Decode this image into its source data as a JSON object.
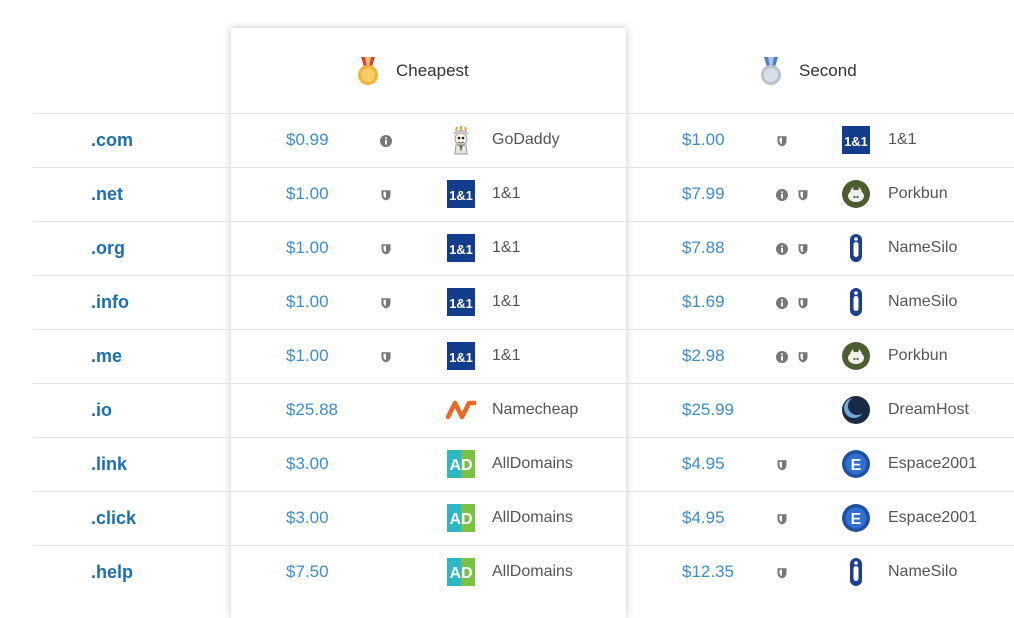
{
  "columns": [
    {
      "label": "Cheapest",
      "medal": "gold-medal-icon"
    },
    {
      "label": "Second",
      "medal": "silver-medal-icon"
    }
  ],
  "rows": [
    {
      "tld": ".com",
      "cheapest": {
        "price": "$0.99",
        "registrar": "GoDaddy",
        "logo": "godaddy",
        "badges": [
          "info"
        ]
      },
      "second": {
        "price": "$1.00",
        "registrar": "1&1",
        "logo": "ionos",
        "badges": [
          "shield"
        ]
      }
    },
    {
      "tld": ".net",
      "cheapest": {
        "price": "$1.00",
        "registrar": "1&1",
        "logo": "ionos",
        "badges": [
          "shield"
        ]
      },
      "second": {
        "price": "$7.99",
        "registrar": "Porkbun",
        "logo": "porkbun",
        "badges": [
          "info",
          "shield"
        ]
      }
    },
    {
      "tld": ".org",
      "cheapest": {
        "price": "$1.00",
        "registrar": "1&1",
        "logo": "ionos",
        "badges": [
          "shield"
        ]
      },
      "second": {
        "price": "$7.88",
        "registrar": "NameSilo",
        "logo": "namesilo",
        "badges": [
          "info",
          "shield"
        ]
      }
    },
    {
      "tld": ".info",
      "cheapest": {
        "price": "$1.00",
        "registrar": "1&1",
        "logo": "ionos",
        "badges": [
          "shield"
        ]
      },
      "second": {
        "price": "$1.69",
        "registrar": "NameSilo",
        "logo": "namesilo",
        "badges": [
          "info",
          "shield"
        ]
      }
    },
    {
      "tld": ".me",
      "cheapest": {
        "price": "$1.00",
        "registrar": "1&1",
        "logo": "ionos",
        "badges": [
          "shield"
        ]
      },
      "second": {
        "price": "$2.98",
        "registrar": "Porkbun",
        "logo": "porkbun",
        "badges": [
          "info",
          "shield"
        ]
      }
    },
    {
      "tld": ".io",
      "cheapest": {
        "price": "$25.88",
        "registrar": "Namecheap",
        "logo": "namecheap",
        "badges": []
      },
      "second": {
        "price": "$25.99",
        "registrar": "DreamHost",
        "logo": "dreamhost",
        "badges": []
      }
    },
    {
      "tld": ".link",
      "cheapest": {
        "price": "$3.00",
        "registrar": "AllDomains",
        "logo": "alldomains",
        "badges": []
      },
      "second": {
        "price": "$4.95",
        "registrar": "Espace2001",
        "logo": "espace2001",
        "badges": [
          "shield"
        ]
      }
    },
    {
      "tld": ".click",
      "cheapest": {
        "price": "$3.00",
        "registrar": "AllDomains",
        "logo": "alldomains",
        "badges": []
      },
      "second": {
        "price": "$4.95",
        "registrar": "Espace2001",
        "logo": "espace2001",
        "badges": [
          "shield"
        ]
      }
    },
    {
      "tld": ".help",
      "cheapest": {
        "price": "$7.50",
        "registrar": "AllDomains",
        "logo": "alldomains",
        "badges": []
      },
      "second": {
        "price": "$12.35",
        "registrar": "NameSilo",
        "logo": "namesilo",
        "badges": [
          "shield"
        ]
      }
    }
  ],
  "colors": {
    "tld": "#1a6fb5",
    "price": "#3d8ccc",
    "text": "#555555",
    "divider": "#e4e4e4"
  }
}
